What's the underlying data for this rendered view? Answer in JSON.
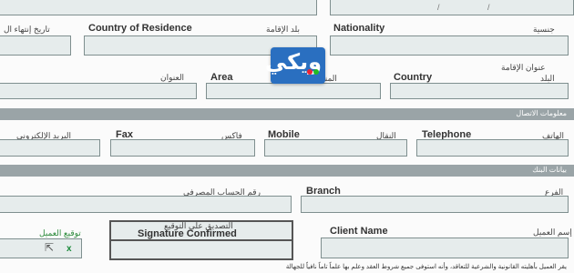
{
  "top_fields": {
    "slash_1": "/",
    "slash_2": "/"
  },
  "personal": {
    "expiry_date_ar": "تاريخ إنتهاء ال",
    "country_of_residence_en": "Country of Residence",
    "country_of_residence_ar": "بلد الإقامة",
    "nationality_en": "Nationality",
    "nationality_ar": "جنسية"
  },
  "residence_address": {
    "section_ar": "عنوان الإقامة",
    "address_ar": "العنوان",
    "area_en": "Area",
    "area_ar": "المنطقة",
    "country_en": "Country",
    "country_ar": "البلد"
  },
  "contact": {
    "band_label": "معلومات الاتصال",
    "email_ar": "البريد الإلكتروني",
    "fax_en": "Fax",
    "fax_ar": "فاكس",
    "mobile_en": "Mobile",
    "mobile_ar": "النقال",
    "telephone_en": "Telephone",
    "telephone_ar": "الهاتف"
  },
  "bank": {
    "band_label": "بيانات البنك",
    "account_ar": "رقم الحساب المصرفي",
    "branch_en": "Branch",
    "branch_ar": "الفرع"
  },
  "signature": {
    "client_signature_ar": "توقيع العميل",
    "confirmed_ar": "التصديق على التوقيع",
    "confirmed_en": "Signature Confirmed",
    "client_name_en": "Client Name",
    "client_name_ar": "إسم العميل"
  },
  "footer_text": "يقر العميل بأهليته القانونية والشرعية للتعاقد، وأنه استوفى جميع شروط العقد وعلم بها علماً تاماً نافياً للجهالة",
  "watermark": {
    "logo_text": "ويكي",
    "brand_color": "#2a6fc0"
  },
  "colors": {
    "field_fill": "#e6ecec",
    "band": "#9aa4a7"
  }
}
